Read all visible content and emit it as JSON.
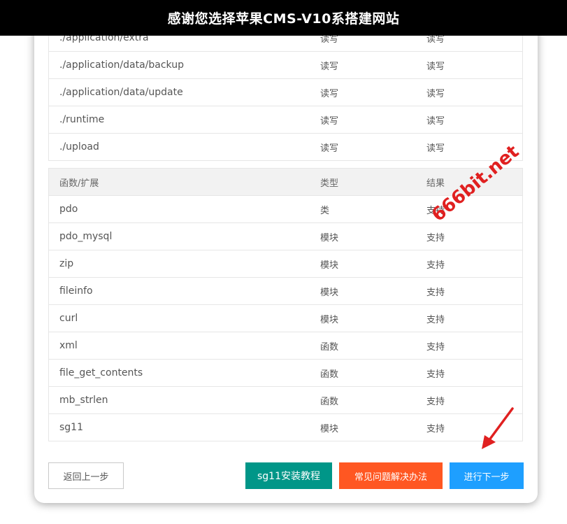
{
  "header": {
    "title": "感谢您选择苹果CMS-V10系搭建网站"
  },
  "dir_table": {
    "rows": [
      {
        "path": "./application/extra",
        "req": "读写",
        "cur": "读写"
      },
      {
        "path": "./application/data/backup",
        "req": "读写",
        "cur": "读写"
      },
      {
        "path": "./application/data/update",
        "req": "读写",
        "cur": "读写"
      },
      {
        "path": "./runtime",
        "req": "读写",
        "cur": "读写"
      },
      {
        "path": "./upload",
        "req": "读写",
        "cur": "读写"
      }
    ]
  },
  "func_table": {
    "headers": {
      "name": "函数/扩展",
      "type": "类型",
      "result": "结果"
    },
    "rows": [
      {
        "name": "pdo",
        "type": "类",
        "result": "支持"
      },
      {
        "name": "pdo_mysql",
        "type": "模块",
        "result": "支持"
      },
      {
        "name": "zip",
        "type": "模块",
        "result": "支持"
      },
      {
        "name": "fileinfo",
        "type": "模块",
        "result": "支持"
      },
      {
        "name": "curl",
        "type": "模块",
        "result": "支持"
      },
      {
        "name": "xml",
        "type": "函数",
        "result": "支持"
      },
      {
        "name": "file_get_contents",
        "type": "函数",
        "result": "支持"
      },
      {
        "name": "mb_strlen",
        "type": "函数",
        "result": "支持"
      },
      {
        "name": "sg11",
        "type": "模块",
        "result": "支持"
      }
    ]
  },
  "buttons": {
    "prev": "返回上一步",
    "sg11": "sg11安装教程",
    "faq": "常见问题解决办法",
    "next": "进行下一步"
  },
  "watermark": "666bit.net",
  "colors": {
    "header_bg": "#000000",
    "sg11_button": "#009688",
    "faq_button": "#ff5722",
    "next_button": "#1e9fff",
    "watermark": "#e02020"
  },
  "icons": {
    "annotation": "red-arrow-icon"
  }
}
